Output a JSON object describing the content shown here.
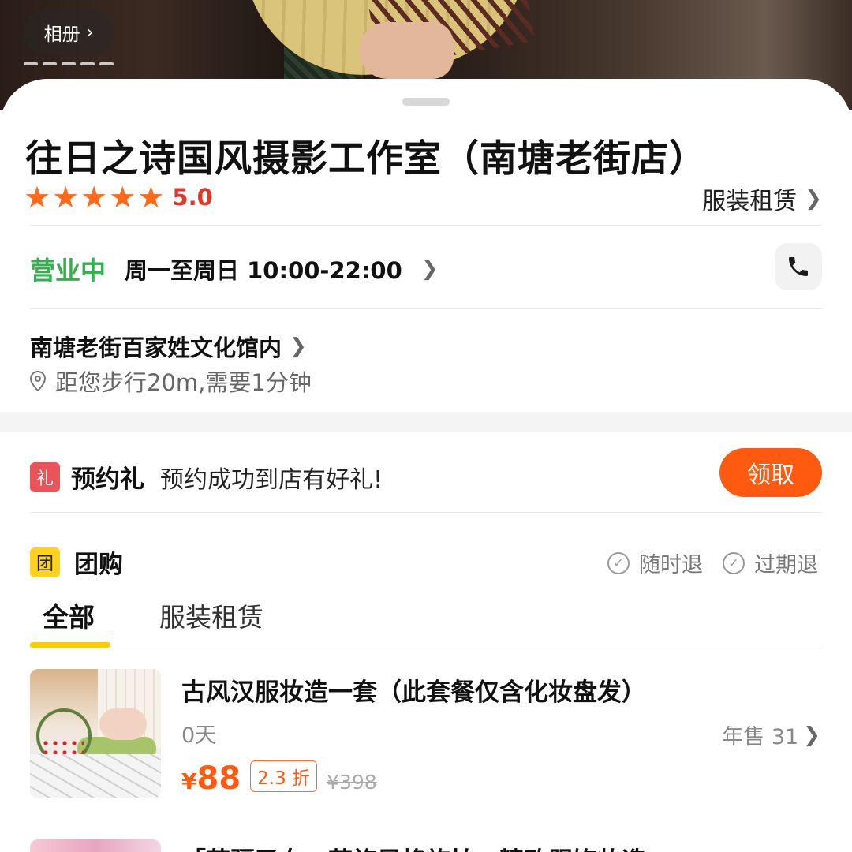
{
  "hero": {
    "album_label": "相册",
    "album_chevron": "›",
    "photo_count_dots": 5
  },
  "shop": {
    "name": "往日之诗国风摄影工作室（南塘老街店）",
    "rating_stars": 5,
    "rating_score": "5.0",
    "category": "服装租赁",
    "status": "营业中",
    "hours": "周一至周日 10:00-22:00",
    "address": "南塘老街百家姓文化馆内",
    "distance": "距您步行20m,需要1分钟"
  },
  "gift": {
    "badge": "礼",
    "title": "预约礼",
    "description": "预约成功到店有好礼!",
    "button": "领取"
  },
  "group_buy": {
    "badge": "团",
    "title": "团购",
    "policies": [
      "随时退",
      "过期退"
    ],
    "tabs": [
      {
        "label": "全部",
        "active": true
      },
      {
        "label": "服装租赁",
        "active": false
      }
    ]
  },
  "deals": [
    {
      "title": "古风汉服妆造一套（此套餐仅含化妆盘发）",
      "days": "0天",
      "sales": "年售 31",
      "currency": "¥",
      "price": "88",
      "discount": "2.3 折",
      "original_price": "¥398"
    },
    {
      "title": "「苗疆圣女」苗族风格旅拍，精致服饰妆造"
    }
  ],
  "colors": {
    "accent_orange": "#ff5a0f",
    "star_orange": "#ff6a1a",
    "score_red": "#e2372b",
    "open_green": "#2fb34a",
    "tab_underline": "#ffcc00",
    "gift_badge": "#e9545a",
    "group_badge": "#ffd21f"
  },
  "icons": [
    "chevron-right-icon",
    "star-icon",
    "phone-icon",
    "location-pin-icon",
    "check-circle-icon"
  ]
}
